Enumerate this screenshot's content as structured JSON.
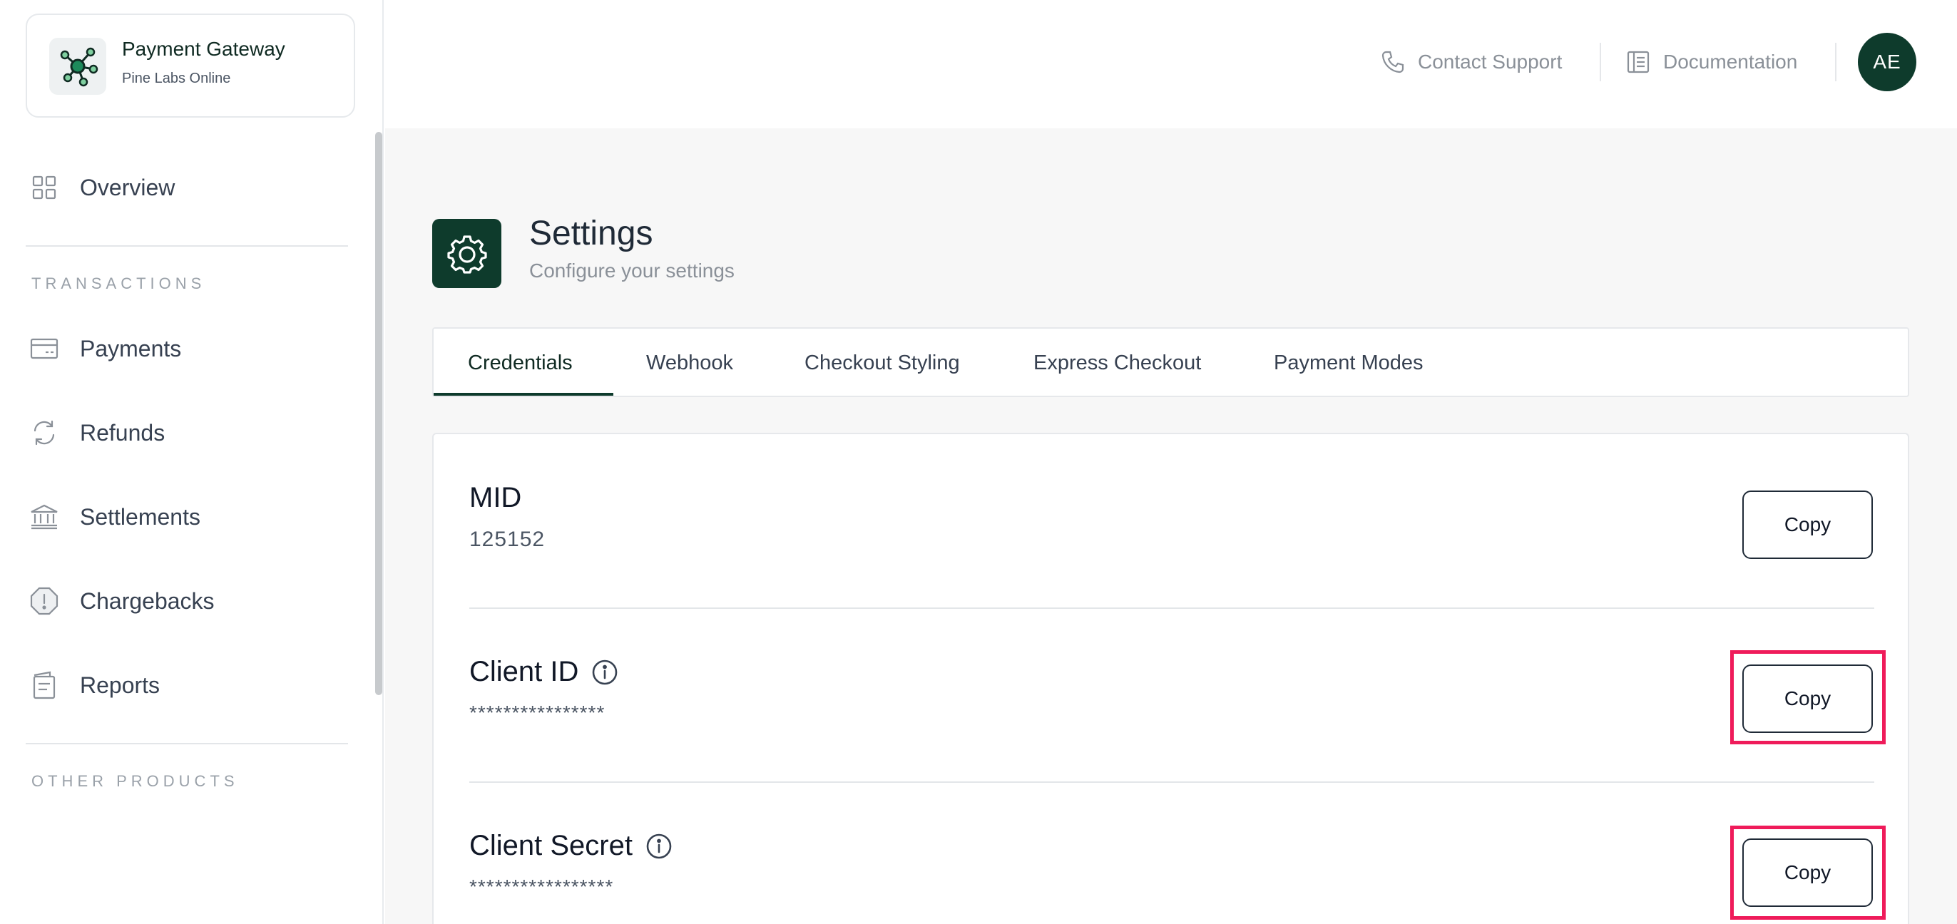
{
  "brand": {
    "title": "Payment Gateway",
    "subtitle": "Pine Labs Online"
  },
  "sidebar": {
    "overview": "Overview",
    "section_transactions": "TRANSACTIONS",
    "items": [
      {
        "label": "Payments",
        "icon": "card-icon"
      },
      {
        "label": "Refunds",
        "icon": "refresh-icon"
      },
      {
        "label": "Settlements",
        "icon": "bank-icon"
      },
      {
        "label": "Chargebacks",
        "icon": "alert-octagon-icon"
      },
      {
        "label": "Reports",
        "icon": "report-icon"
      }
    ],
    "section_other": "OTHER PRODUCTS"
  },
  "topbar": {
    "contact_support": "Contact Support",
    "documentation": "Documentation",
    "avatar_initials": "AE"
  },
  "page": {
    "title": "Settings",
    "subtitle": "Configure your settings"
  },
  "tabs": [
    {
      "label": "Credentials",
      "active": true
    },
    {
      "label": "Webhook",
      "active": false
    },
    {
      "label": "Checkout Styling",
      "active": false
    },
    {
      "label": "Express Checkout",
      "active": false
    },
    {
      "label": "Payment Modes",
      "active": false
    }
  ],
  "credentials": {
    "mid_label": "MID",
    "mid_value": "125152",
    "client_id_label": "Client ID",
    "client_id_value": "****************",
    "client_secret_label": "Client Secret",
    "client_secret_value": "*****************",
    "copy_label": "Copy"
  },
  "colors": {
    "brand_dark_green": "#0e3b2c",
    "highlight_pink": "#ef1b5a"
  }
}
